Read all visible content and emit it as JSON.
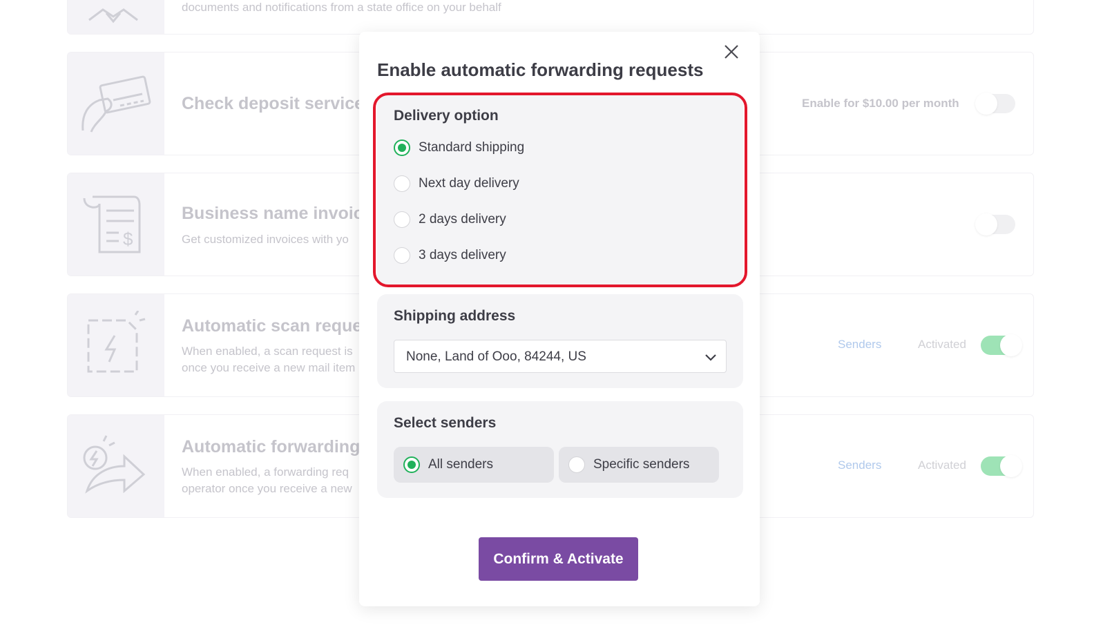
{
  "background": {
    "top_card": {
      "description": "documents and notifications from a state office on your behalf"
    },
    "check_deposit": {
      "title": "Check deposit service",
      "price_label": "Enable for $10.00 per month"
    },
    "business_invoice": {
      "title": "Business name invoices",
      "description": "Get customized invoices with yo"
    },
    "auto_scan": {
      "title": "Automatic scan reques",
      "desc_line1": "When enabled, a scan request is",
      "desc_line2": "once you receive a new mail item",
      "senders_link": "Senders",
      "status": "Activated"
    },
    "auto_forward": {
      "title": "Automatic forwarding r",
      "desc_line1": "When enabled, a forwarding req",
      "desc_line2": "operator once you receive a new",
      "senders_link": "Senders",
      "status": "Activated"
    }
  },
  "modal": {
    "title": "Enable automatic forwarding requests",
    "delivery": {
      "heading": "Delivery option",
      "options": [
        {
          "label": "Standard shipping",
          "selected": true
        },
        {
          "label": "Next day delivery",
          "selected": false
        },
        {
          "label": "2 days delivery",
          "selected": false
        },
        {
          "label": "3 days delivery",
          "selected": false
        }
      ]
    },
    "shipping": {
      "heading": "Shipping address",
      "selected_value": "None, Land of Ooo, 84244, US"
    },
    "senders": {
      "heading": "Select senders",
      "options": [
        {
          "label": "All senders",
          "selected": true
        },
        {
          "label": "Specific senders",
          "selected": false
        }
      ]
    },
    "confirm_label": "Confirm & Activate"
  },
  "colors": {
    "accent_purple": "#7a4ba3",
    "radio_green": "#20b15a",
    "highlight_red": "#e3172c",
    "toggle_on": "#9ee3b6"
  },
  "icons": [
    "close-icon",
    "chevron-down-icon",
    "handshake-icon",
    "check-deposit-icon",
    "invoice-icon",
    "scan-icon",
    "forward-icon"
  ]
}
